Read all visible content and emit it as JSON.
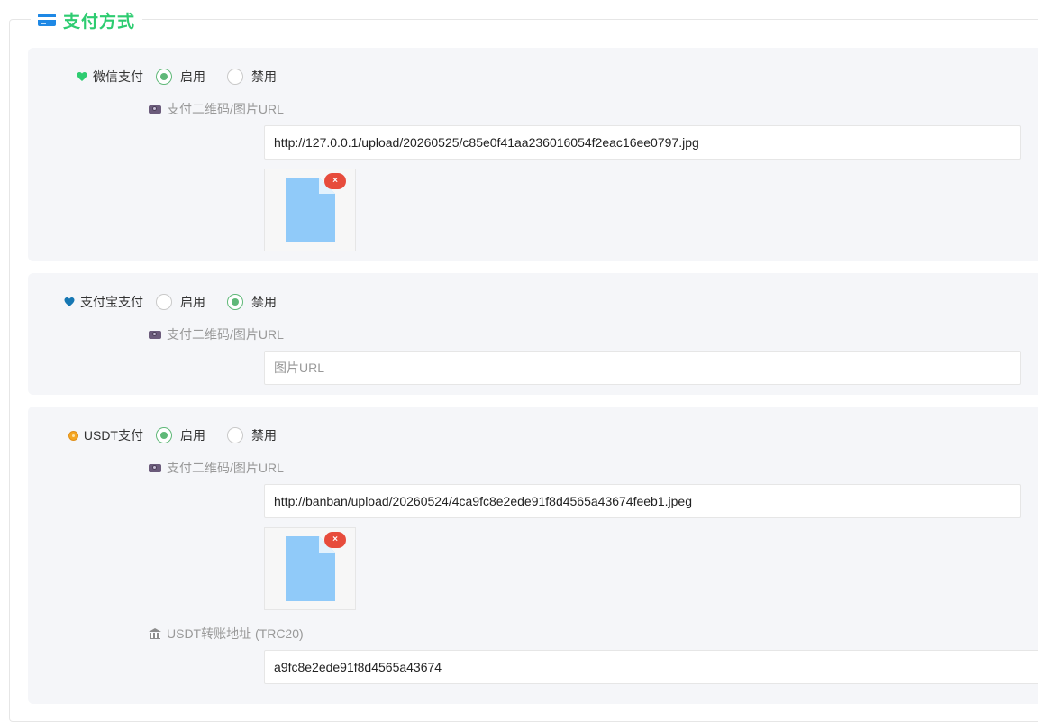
{
  "section": {
    "title": "支付方式"
  },
  "methods": [
    {
      "name": "微信支付",
      "heart_color": "#2ecc71",
      "enabled": true,
      "enable_label": "启用",
      "disable_label": "禁用",
      "qr_label": "支付二维码/图片URL",
      "url_value": "http://127.0.0.1/upload/20260525/c85e0f41aa236016054f2eac16ee0797.jpg",
      "url_placeholder": "图片URL",
      "has_thumb": true,
      "remove_glyph": "×"
    },
    {
      "name": "支付宝支付",
      "heart_color": "#1677b3",
      "enabled": false,
      "enable_label": "启用",
      "disable_label": "禁用",
      "qr_label": "支付二维码/图片URL",
      "url_value": "",
      "url_placeholder": "图片URL",
      "has_thumb": false
    },
    {
      "name": "USDT支付",
      "enabled": true,
      "enable_label": "启用",
      "disable_label": "禁用",
      "qr_label": "支付二维码/图片URL",
      "url_value": "http://banban/upload/20260524/4ca9fc8e2ede91f8d4565a43674feeb1.jpeg",
      "url_placeholder": "图片URL",
      "has_thumb": true,
      "remove_glyph": "×",
      "address_label": "USDT转账地址 (TRC20)",
      "address_value": "a9fc8e2ede91f8d4565a43674"
    }
  ],
  "colors": {
    "accent_green": "#5fb878",
    "title_green": "#2ecc71",
    "delete_red": "#e74c3c",
    "file_blue": "#90caf9"
  }
}
